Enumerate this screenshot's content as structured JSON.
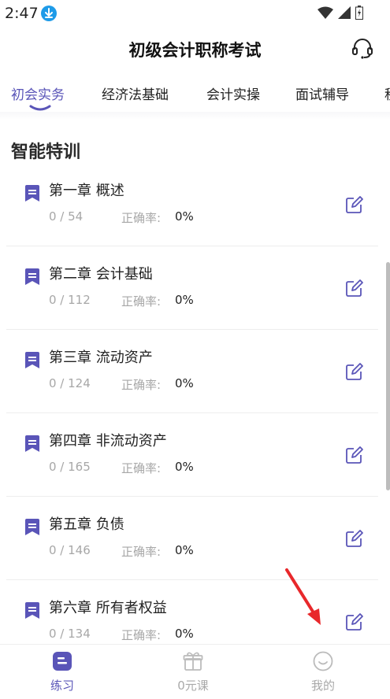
{
  "status_bar": {
    "time": "2:47"
  },
  "header": {
    "title": "初级会计职称考试"
  },
  "tabs": [
    {
      "label": "初会实务",
      "active": true
    },
    {
      "label": "经济法基础",
      "active": false
    },
    {
      "label": "会计实操",
      "active": false
    },
    {
      "label": "面试辅导",
      "active": false
    },
    {
      "label": "税",
      "active": false
    }
  ],
  "section_title": "智能特训",
  "accuracy_label": "正确率:",
  "chapters": [
    {
      "title": "第一章 概述",
      "progress": "0 / 54",
      "accuracy": "0%"
    },
    {
      "title": "第二章 会计基础",
      "progress": "0 / 112",
      "accuracy": "0%"
    },
    {
      "title": "第三章 流动资产",
      "progress": "0 / 124",
      "accuracy": "0%"
    },
    {
      "title": "第四章 非流动资产",
      "progress": "0 / 165",
      "accuracy": "0%"
    },
    {
      "title": "第五章 负债",
      "progress": "0 / 146",
      "accuracy": "0%"
    },
    {
      "title": "第六章 所有者权益",
      "progress": "0 / 134",
      "accuracy": "0%"
    }
  ],
  "bottom_nav": [
    {
      "label": "练习",
      "icon": "practice-icon",
      "active": true
    },
    {
      "label": "0元课",
      "icon": "gift-icon",
      "active": false
    },
    {
      "label": "我的",
      "icon": "profile-smile-icon",
      "active": false
    }
  ],
  "colors": {
    "accent": "#5a55b8",
    "muted": "#a7a7a7",
    "annotation_arrow": "#e8282b",
    "download_badge": "#1e9be8"
  }
}
